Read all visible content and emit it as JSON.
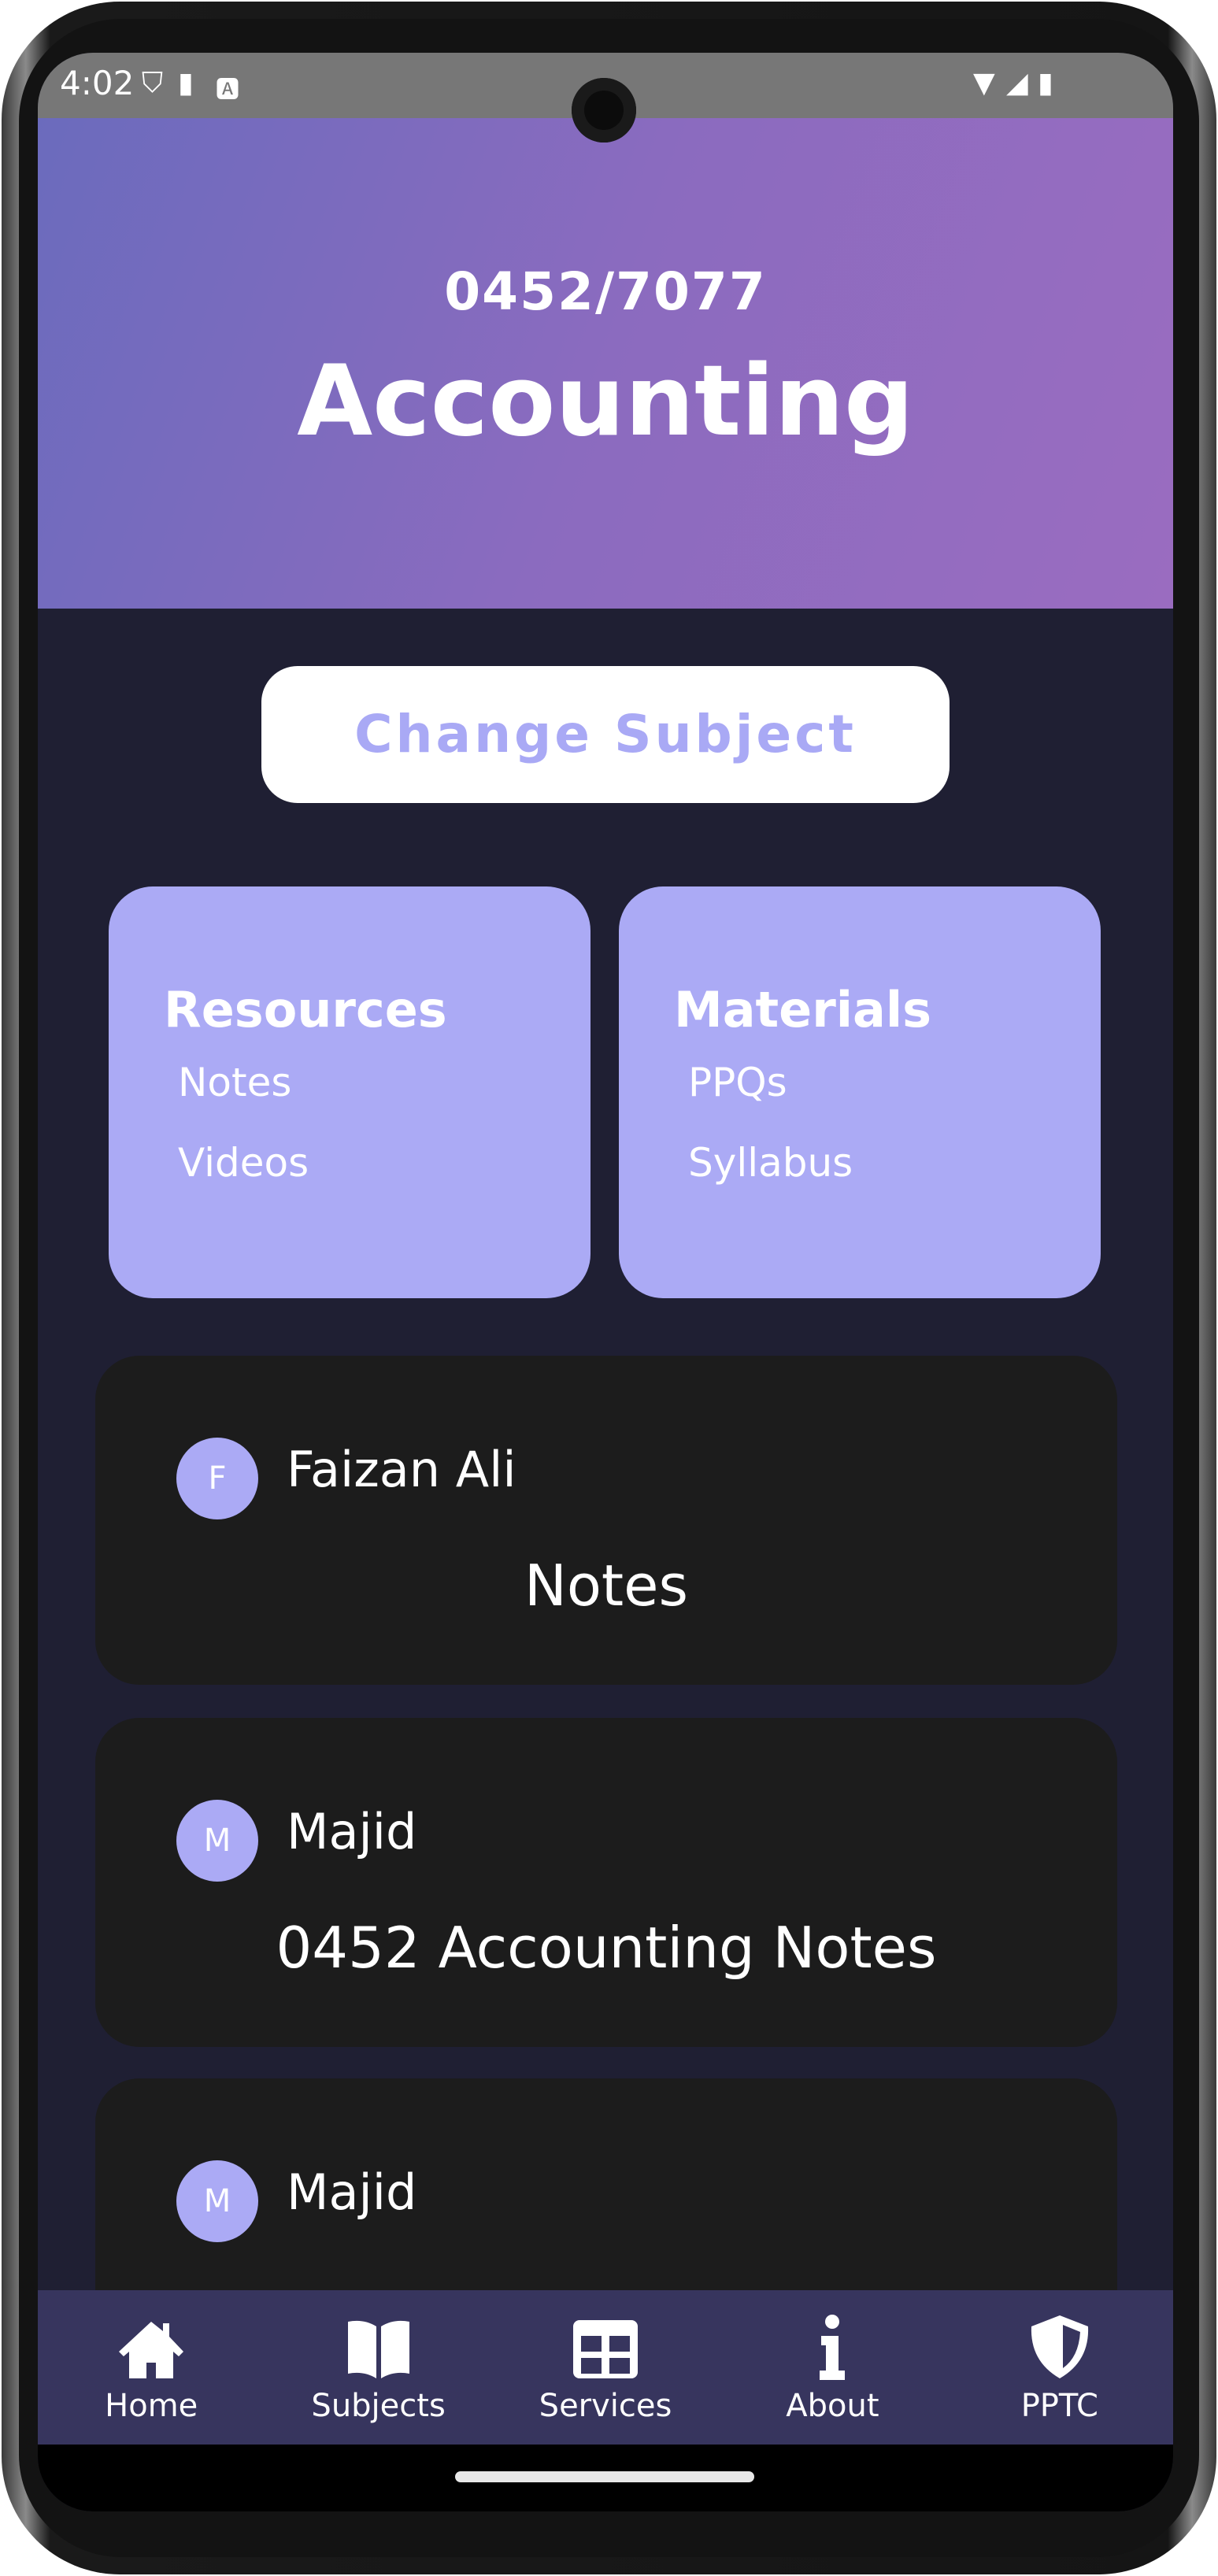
{
  "status_bar": {
    "time": "4:02",
    "icons": [
      "play-protect-icon",
      "sd-card-icon",
      "font-a-icon",
      "wifi-icon",
      "signal-icon",
      "battery-icon"
    ]
  },
  "header": {
    "code": "0452/7077",
    "title": "Accounting"
  },
  "change_subject_label": "Change Subject",
  "tiles": [
    {
      "title": "Resources",
      "links": [
        "Notes",
        "Videos"
      ]
    },
    {
      "title": "Materials",
      "links": [
        "PPQs",
        "Syllabus"
      ]
    }
  ],
  "posts": [
    {
      "initial": "F",
      "author": "Faizan Ali",
      "title": "Notes"
    },
    {
      "initial": "M",
      "author": "Majid",
      "title": "0452 Accounting Notes"
    },
    {
      "initial": "M",
      "author": "Majid",
      "title": ""
    }
  ],
  "nav": [
    {
      "label": "Home",
      "icon": "home-icon"
    },
    {
      "label": "Subjects",
      "icon": "book-icon"
    },
    {
      "label": "Services",
      "icon": "grid-icon"
    },
    {
      "label": "About",
      "icon": "info-icon"
    },
    {
      "label": "PPTC",
      "icon": "shield-icon"
    }
  ],
  "colors": {
    "accent": "#abaaf5",
    "background": "#1f1f33",
    "card": "#1c1c1c",
    "nav": "#37355e"
  }
}
